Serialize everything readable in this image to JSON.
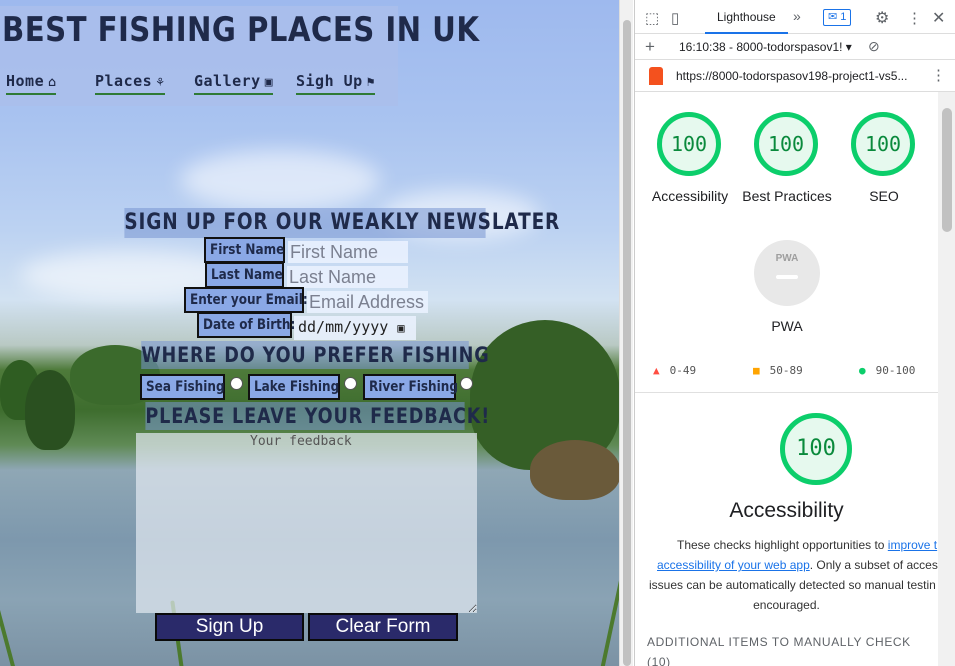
{
  "site": {
    "title": "BEST FISHING PLACES IN UK",
    "nav": [
      {
        "label": "Home",
        "icon": "⌂"
      },
      {
        "label": "Places",
        "icon": "⚘"
      },
      {
        "label": "Gallery",
        "icon": "▣"
      },
      {
        "label": "Sigh Up",
        "icon": "⚑"
      }
    ],
    "form": {
      "heading": "SIGN UP FOR OUR WEAKLY NEWSLATER",
      "first_name_label": "First Name",
      "first_name_placeholder": "First Name",
      "last_name_label": "Last Name",
      "last_name_placeholder": "Last Name",
      "email_label": "Enter your Email:",
      "email_placeholder": "Email Address",
      "dob_label": "Date of Birth:",
      "dob_value": "dd/mm/yyyy",
      "fishing_heading": "WHERE DO YOU PREFER FISHING",
      "options": [
        "Sea Fishing",
        "Lake Fishing",
        "River Fishing"
      ],
      "feedback_heading": "PLEASE LEAVE YOUR FEEDBACK!",
      "feedback_placeholder": "Your feedback",
      "submit_label": "Sign Up",
      "clear_label": "Clear Form"
    }
  },
  "devtools": {
    "tab": "Lighthouse",
    "issues_count": "1",
    "report_time": "16:10:38 - 8000-todorspasov1!",
    "url": "https://8000-todorspasov198-project1-vs5...",
    "scores": [
      {
        "value": "100",
        "label": "Accessibility"
      },
      {
        "value": "100",
        "label": "Best Practices"
      },
      {
        "value": "100",
        "label": "SEO"
      }
    ],
    "pwa_label": "PWA",
    "pwa_badge": "PWA",
    "legend": [
      "0-49",
      "50-89",
      "90-100"
    ],
    "main_score": "100",
    "main_title": "Accessibility",
    "desc_1": "These checks highlight opportunities to ",
    "desc_link_1": "improve t",
    "desc_link_2": "accessibility of your web app",
    "desc_2": ". Only a subset of acces",
    "desc_3": "issues can be automatically detected so manual testin",
    "desc_4": "encouraged.",
    "additional": "ADDITIONAL ITEMS TO MANUALLY CHECK",
    "additional_count": "(10)",
    "colors": {
      "pass": "#0cce6b",
      "average": "#ffa400",
      "fail": "#ff4e42",
      "accent": "#1a73e8"
    }
  }
}
